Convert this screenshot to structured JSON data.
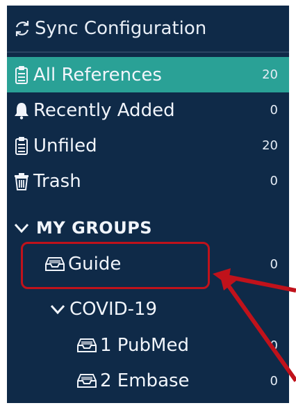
{
  "sync": {
    "label": "Sync Configuration",
    "icon": "sync-icon"
  },
  "library": [
    {
      "label": "All References",
      "count": "20",
      "icon": "clipboard-icon",
      "selected": true
    },
    {
      "label": "Recently Added",
      "count": "0",
      "icon": "bell-icon",
      "selected": false
    },
    {
      "label": "Unfiled",
      "count": "20",
      "icon": "clipboard-icon",
      "selected": false
    },
    {
      "label": "Trash",
      "count": "0",
      "icon": "trash-icon",
      "selected": false
    }
  ],
  "groups": {
    "header": "MY GROUPS",
    "items": [
      {
        "label": "Guide",
        "count": "0",
        "icon": "inbox-icon"
      },
      {
        "label": "COVID-19",
        "icon": "chevron-down-icon"
      },
      {
        "label": "1 PubMed",
        "count": "0",
        "icon": "inbox-icon"
      },
      {
        "label": "2 Embase",
        "count": "0",
        "icon": "inbox-icon"
      }
    ]
  },
  "colors": {
    "panel_bg": "#0f2a48",
    "selected_bg": "#2aa196",
    "annotation": "#c0121b",
    "text": "#f1f5fb"
  }
}
